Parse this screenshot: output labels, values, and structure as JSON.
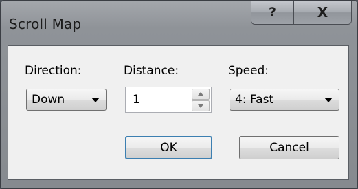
{
  "window": {
    "title": "Scroll Map",
    "help_label": "?",
    "close_label": "X"
  },
  "direction": {
    "label": "Direction:",
    "value": "Down"
  },
  "distance": {
    "label": "Distance:",
    "value": "1"
  },
  "speed": {
    "label": "Speed:",
    "value": "4: Fast"
  },
  "buttons": {
    "ok": "OK",
    "cancel": "Cancel"
  },
  "icons": {
    "help": "help-icon",
    "close": "close-icon",
    "dropdown": "chevron-down-icon",
    "spin_up": "spin-up-icon",
    "spin_down": "spin-down-icon"
  }
}
